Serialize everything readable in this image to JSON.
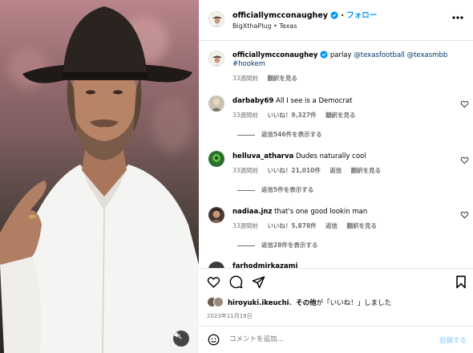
{
  "header": {
    "username": "officiallymcconaughey",
    "separator": "•",
    "follow_label": "フォロー",
    "subtitle": "BigXthaPlug • Texas",
    "more_icon": "more-horizontal-icon"
  },
  "caption": {
    "username": "officiallymcconaughey",
    "text": "parlay",
    "mentions": "@texasfootball @texasmbb",
    "hashtag": "#hookem",
    "time": "33週間前",
    "translate": "翻訳を見る"
  },
  "comments": [
    {
      "username": "darbaby69",
      "text": "All I see is a Democrat",
      "time": "33週間前",
      "likes": "いいね！9,327件",
      "reply": "",
      "translate": "翻訳を見る",
      "replies_label": "返信546件を表示する"
    },
    {
      "username": "helluva_atharva",
      "text": "Dudes naturally cool",
      "time": "33週間前",
      "likes": "いいね！21,010件",
      "reply": "返信",
      "translate": "翻訳を見る",
      "replies_label": "返信5件を表示する"
    },
    {
      "username": "nadiaa.jnz",
      "text": "that's one good lookin man",
      "time": "33週間前",
      "likes": "いいね！5,878件",
      "reply": "返信",
      "translate": "翻訳を見る",
      "replies_label": "返信28件を表示する"
    }
  ],
  "partial_comment_username": "farhodmirkazami",
  "likes": {
    "user": "hiroyuki.ikeuchi",
    "mid": "、",
    "others": "その他",
    "suffix": "が「いいね！」しました"
  },
  "date": "2023年11月19日",
  "comment_input": {
    "placeholder": "コメントを追加...",
    "post_label": "投稿する"
  },
  "colors": {
    "accent": "#0095f6",
    "verified": "#0095f6",
    "muted": "#737373",
    "post_disabled": "#b3dbff"
  }
}
